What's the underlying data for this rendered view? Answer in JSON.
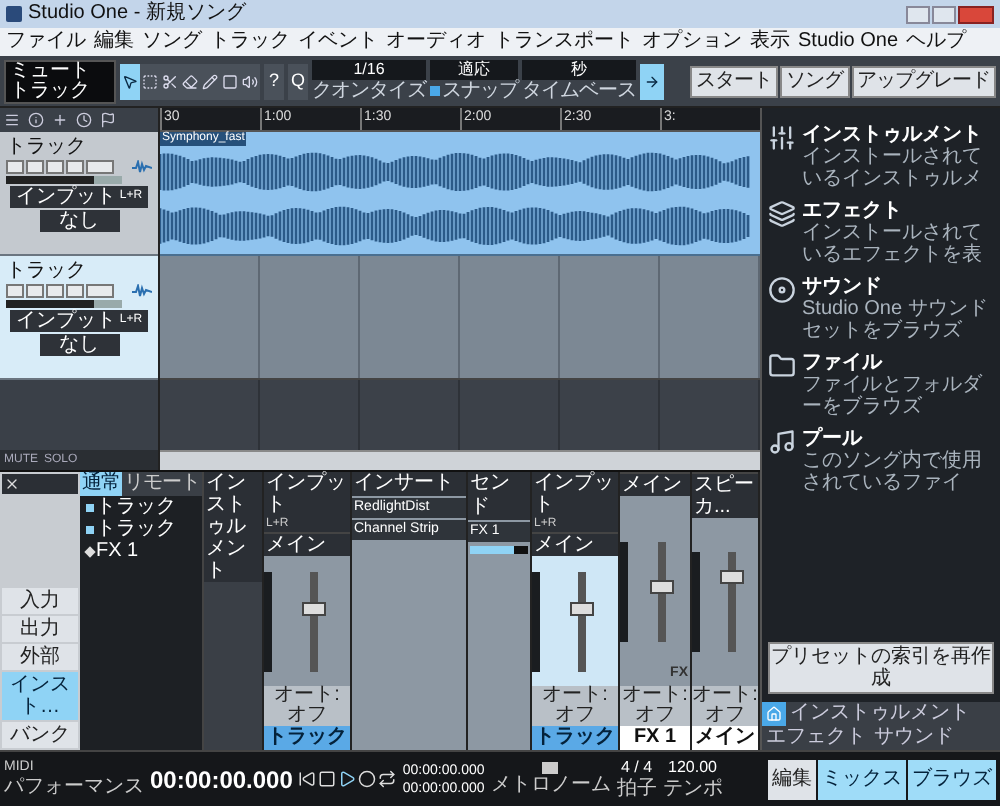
{
  "window": {
    "title": "Studio One - 新規ソング"
  },
  "menu": [
    "ファイル",
    "編集",
    "ソング",
    "トラック",
    "イベント",
    "オーディオ",
    "トランスポート",
    "オプション",
    "表示",
    "Studio One",
    "ヘルプ"
  ],
  "toolbar": {
    "track_info": {
      "name": "ミュート",
      "track": "トラック"
    },
    "tools": [
      {
        "kind": "arrow",
        "selected": true
      },
      {
        "kind": "range",
        "selected": false
      },
      {
        "kind": "split",
        "selected": false
      },
      {
        "kind": "eraser",
        "selected": false
      },
      {
        "kind": "pencil",
        "selected": false
      },
      {
        "kind": "mute",
        "selected": false
      },
      {
        "kind": "listen",
        "selected": false
      }
    ],
    "help": "?",
    "quantize_button": "Q",
    "quantize": {
      "value": "1/16",
      "label": "クオンタイズ"
    },
    "snap": {
      "value": "適応",
      "label": "スナップ",
      "checked": true
    },
    "timebase": {
      "value": "秒",
      "label": "タイムベース"
    },
    "follow": {
      "on": true
    }
  },
  "nav_buttons": [
    "スタート",
    "ソング",
    "アップグレード"
  ],
  "tracks": [
    {
      "name": "トラック",
      "selected": false,
      "input": "インプット",
      "input_channels": "L+R",
      "output": "なし",
      "level": 0.75
    },
    {
      "name": "トラック",
      "selected": true,
      "input": "インプット",
      "input_channels": "L+R",
      "output": "なし",
      "level": 0.75
    }
  ],
  "ruler": [
    "30",
    "1:00",
    "1:30",
    "2:00",
    "2:30",
    "3:"
  ],
  "clip": {
    "name": "Symphony_fast"
  },
  "arrange_footer": {
    "mute": "MUTE",
    "solo": "SOLO"
  },
  "browser": {
    "items": [
      {
        "kind": "instrument",
        "title": "インストゥルメント",
        "description": "インストールされているインストゥルメ"
      },
      {
        "kind": "effect",
        "title": "エフェクト",
        "description": "インストールされているエフェクトを表"
      },
      {
        "kind": "sound",
        "title": "サウンド",
        "description": "Studio One サウンドセットをブラウズ"
      },
      {
        "kind": "file",
        "title": "ファイル",
        "description": "ファイルとフォルダーをブラウズ"
      },
      {
        "kind": "pool",
        "title": "プール",
        "description": "このソング内で使用されているファイ"
      }
    ],
    "rebuild_button": "プリセットの索引を再作成",
    "tabs": [
      {
        "kind": "home",
        "selected": true
      },
      {
        "kind": "text",
        "label": "インストゥルメント",
        "selected": false
      },
      {
        "kind": "text",
        "label": "エフェクト",
        "selected": false
      },
      {
        "kind": "text",
        "label": "サウンド",
        "selected": false
      }
    ]
  },
  "mixer": {
    "nav": [
      {
        "label": "入力",
        "selected": false
      },
      {
        "label": "出力",
        "selected": false
      },
      {
        "label": "外部",
        "selected": false
      },
      {
        "label": "インスト…",
        "selected": true
      },
      {
        "label": "バンク",
        "selected": false
      }
    ],
    "tabs": [
      {
        "label": "通常",
        "selected": true
      },
      {
        "label": "リモート",
        "selected": false
      }
    ],
    "tree": [
      {
        "kind": "audio",
        "label": "トラック"
      },
      {
        "kind": "audio",
        "label": "トラック"
      },
      {
        "kind": "fx",
        "label": "FX 1"
      }
    ],
    "instrument_header": "インストゥルメント",
    "inserts": {
      "title": "インサート",
      "items": [
        "RedlightDist",
        "Channel Strip"
      ]
    },
    "sends": {
      "title": "センド",
      "items": [
        "FX 1"
      ]
    },
    "channels": [
      {
        "kind": "track",
        "input": "インプット",
        "input_channels": "L+R",
        "output": "メイン",
        "automation": "オート: オフ",
        "name": "トラック",
        "selected": false,
        "level": 0.65
      },
      {
        "kind": "track",
        "input": "インプット",
        "input_channels": "L+R",
        "output": "メイン",
        "automation": "オート: オフ",
        "name": "トラック",
        "selected": true,
        "level": 0.65
      },
      {
        "kind": "fx",
        "output": "メイン",
        "badge": "FX",
        "automation": "オート: オフ",
        "name": "FX 1",
        "selected": false,
        "level": 0.55
      },
      {
        "kind": "main",
        "output": "スピーカ...",
        "automation": "オート: オフ",
        "name": "メイン",
        "selected": false,
        "level": 0.8
      }
    ]
  },
  "transport": {
    "midi": "MIDI",
    "performance": "パフォーマンス",
    "time": "00:00:00.000",
    "locators": [
      "00:00:00.000",
      "00:00:00.000"
    ],
    "metronome": "メトロノーム",
    "signature": "4 / 4",
    "signature_label": "拍子",
    "tempo": "120.00",
    "tempo_label": "テンポ"
  },
  "views": [
    {
      "label": "編集",
      "selected": false
    },
    {
      "label": "ミックス",
      "selected": true
    },
    {
      "label": "ブラウズ",
      "selected": true
    }
  ]
}
